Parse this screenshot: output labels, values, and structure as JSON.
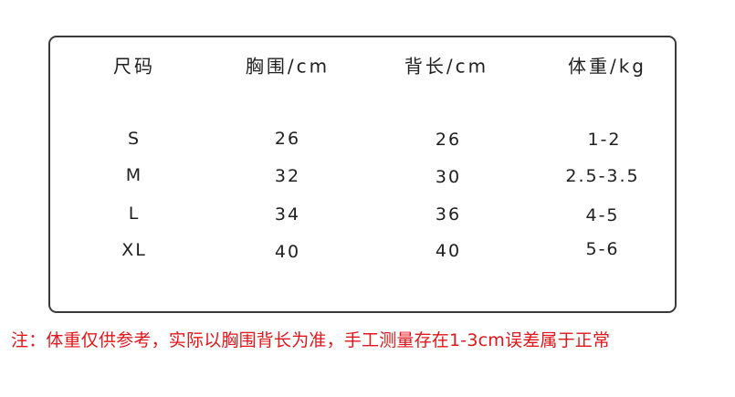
{
  "table": {
    "headers": [
      "尺码",
      "胸围/cm",
      "背长/cm",
      "体重/kg"
    ],
    "rows": [
      {
        "size": "S",
        "chest": "26",
        "back": "26",
        "weight": "1-2"
      },
      {
        "size": "M",
        "chest": "32",
        "back": "30",
        "weight": "2.5-3.5"
      },
      {
        "size": "L",
        "chest": "34",
        "back": "36",
        "weight": "4-5"
      },
      {
        "size": "XL",
        "chest": "40",
        "back": "40",
        "weight": "5-6"
      }
    ]
  },
  "note": "注：体重仅供参考，实际以胸围背长为准，手工测量存在1-3cm误差属于正常",
  "colors": {
    "border": "#3a3a3a",
    "note": "#e0161b",
    "text": "#1f1f1f"
  }
}
